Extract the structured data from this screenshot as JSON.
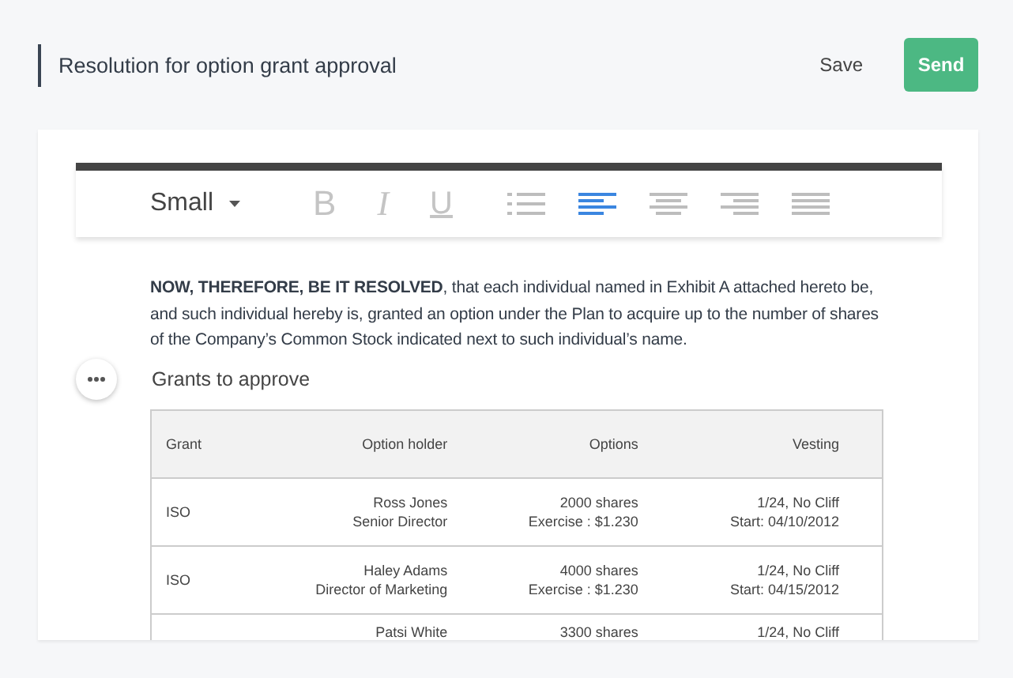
{
  "header": {
    "title": "Resolution for option grant approval",
    "save": "Save",
    "send": "Send"
  },
  "toolbar": {
    "style": "Small",
    "tools": [
      {
        "kind": "bold",
        "glyph": "B",
        "selected": false
      },
      {
        "kind": "italic",
        "glyph": "I",
        "selected": false
      },
      {
        "kind": "underline",
        "glyph": "U",
        "selected": false
      },
      {
        "kind": "bullets",
        "selected": false
      },
      {
        "kind": "left",
        "selected": true
      },
      {
        "kind": "center",
        "selected": false
      },
      {
        "kind": "right",
        "selected": false
      },
      {
        "kind": "justify",
        "selected": false
      }
    ]
  },
  "document": {
    "paragraph": "**NOW, THEREFORE, BE IT RESOLVED**, that each individual named in Exhibit A attached hereto be, and such individual hereby is, granted an option under the Plan to acquire up to the number of shares of the Company’s Common Stock indicated next to such individual’s name.",
    "section_title": "Grants to approve",
    "table": {
      "columns": [
        "Grant",
        "Option holder",
        "Options",
        "Vesting"
      ],
      "rows": [
        {
          "grant": "ISO",
          "holder": [
            "Ross Jones",
            "Senior Director"
          ],
          "options": [
            "2000 shares",
            "Exercise : $1.230"
          ],
          "vesting": [
            "1/24, No Cliff",
            "Start: 04/10/2012"
          ]
        },
        {
          "grant": "ISO",
          "holder": [
            "Haley Adams",
            "Director of Marketing"
          ],
          "options": [
            "4000 shares",
            "Exercise : $1.230"
          ],
          "vesting": [
            "1/24, No Cliff",
            "Start: 04/15/2012"
          ]
        },
        {
          "holder": [
            "Patsi White"
          ],
          "options": [
            "3300 shares"
          ],
          "vesting": [
            "1/24, No Cliff"
          ]
        }
      ]
    }
  }
}
